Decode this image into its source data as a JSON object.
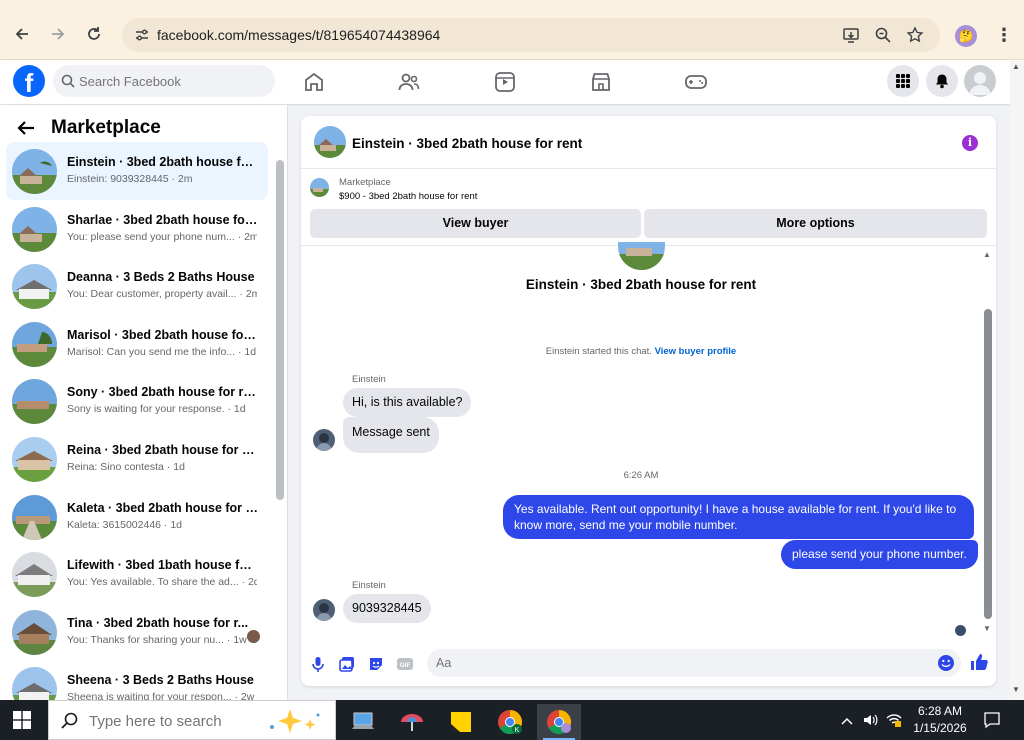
{
  "browser": {
    "url": "facebook.com/messages/t/819654074438964"
  },
  "fb": {
    "search_placeholder": "Search Facebook"
  },
  "sidebar": {
    "title": "Marketplace",
    "conversations": [
      {
        "name": "Einstein · 3bed 2bath house for ...",
        "preview": "Einstein: 9039328445 · 2m",
        "active": true
      },
      {
        "name": "Sharlae · 3bed 2bath house for ...",
        "preview": "You: please send your phone num... · 2m"
      },
      {
        "name": "Deanna · 3 Beds 2 Baths House",
        "preview": "You: Dear customer, property avail... · 2m"
      },
      {
        "name": "Marisol · 3bed 2bath house for ...",
        "preview": "Marisol: Can you send me the info... · 1d"
      },
      {
        "name": "Sony · 3bed 2bath house for rent",
        "preview": "Sony is waiting for your response. · 1d"
      },
      {
        "name": "Reina · 3bed 2bath house for rent",
        "preview": "Reina: Sino contesta · 1d"
      },
      {
        "name": "Kaleta · 3bed 2bath house for r...",
        "preview": "Kaleta: 3615002446 · 1d"
      },
      {
        "name": "Lifewith · 3bed 1bath house for ...",
        "preview": "You: Yes available. To share the ad... · 2d"
      },
      {
        "name": "Tina · 3bed 2bath house for r...",
        "preview": "You: Thanks for sharing your nu... · 1w"
      },
      {
        "name": "Sheena · 3 Beds 2 Baths House",
        "preview": "Sheena is waiting for your respon... · 2w"
      }
    ]
  },
  "chat": {
    "title": "Einstein · 3bed 2bath house for rent",
    "marketplace_label": "Marketplace",
    "listing": "$900 - 3bed 2bath house for rent",
    "view_buyer": "View buyer",
    "more_options": "More options",
    "center_title": "Einstein · 3bed 2bath house for rent",
    "started_text": "Einstein started this chat.",
    "view_buyer_profile": "View buyer profile",
    "sender1": "Einstein",
    "msg1": "Hi, is this available?",
    "msg2": "Message sent",
    "timestamp": "6:26 AM",
    "out1": "Yes available. Rent out opportunity! I have a house available for rent. If you'd like to know more, send me your mobile number.",
    "out2": "please send your phone number.",
    "sender2": "Einstein",
    "msg3": "9039328445",
    "composer_placeholder": "Aa"
  },
  "taskbar": {
    "search_placeholder": "Type here to search",
    "time": "6:28 AM",
    "date": "1/15/2026"
  },
  "colors": {
    "fb_blue": "#0866ff",
    "outgoing_bubble": "#2d47e8",
    "info_purple": "#9b2fd6"
  }
}
